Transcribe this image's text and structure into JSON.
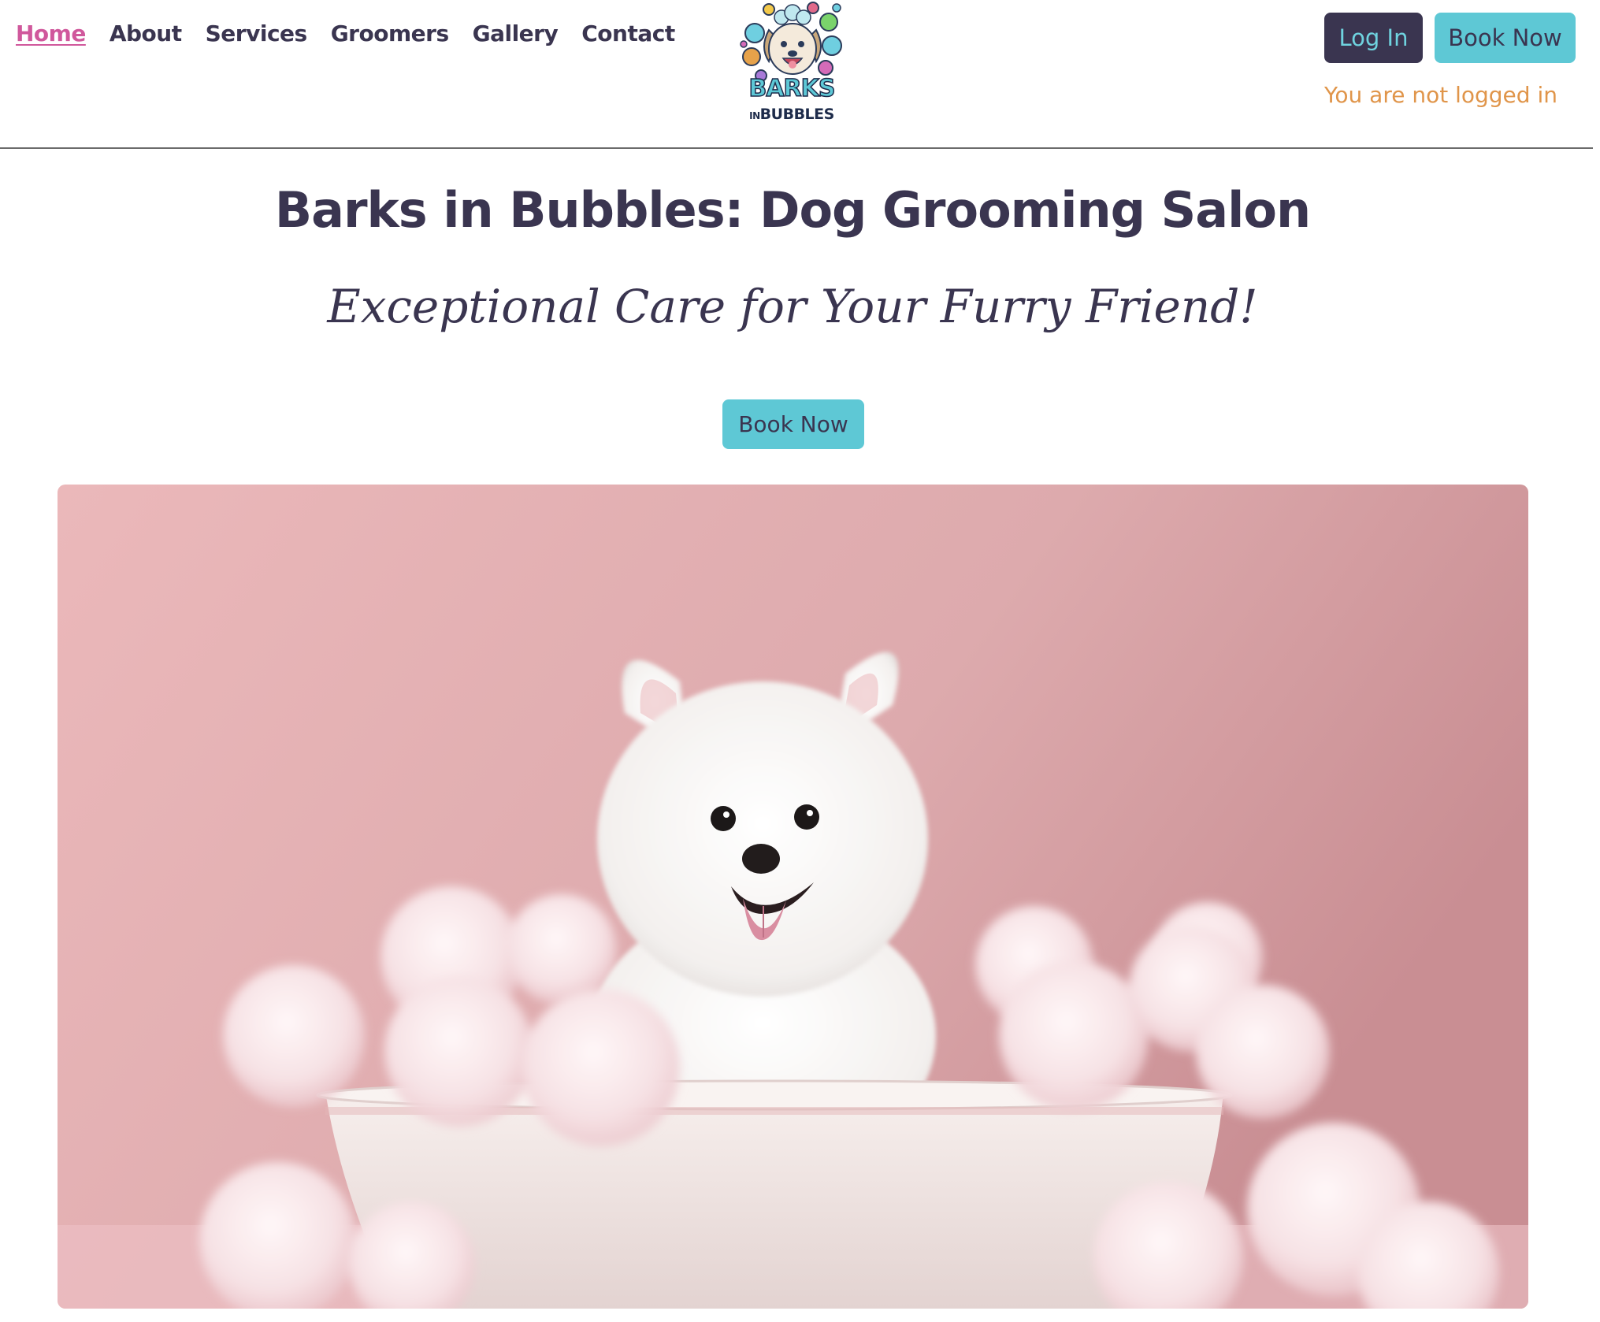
{
  "nav": {
    "items": [
      {
        "label": "Home",
        "active": true
      },
      {
        "label": "About",
        "active": false
      },
      {
        "label": "Services",
        "active": false
      },
      {
        "label": "Groomers",
        "active": false
      },
      {
        "label": "Gallery",
        "active": false
      },
      {
        "label": "Contact",
        "active": false
      }
    ]
  },
  "logo": {
    "line1": "BARKS",
    "line2_small": "IN",
    "line2": "BUBBLES"
  },
  "header": {
    "login_label": "Log In",
    "book_label": "Book Now",
    "status": "You are not logged in"
  },
  "hero": {
    "title": "Barks in Bubbles: Dog Grooming Salon",
    "subtitle": "Exceptional Care for Your Furry Friend!",
    "cta_label": "Book Now",
    "image_subject": "white-dog-in-bubble-bath"
  },
  "colors": {
    "primary_dark": "#3a3550",
    "accent_teal": "#5ec8d5",
    "active_pink": "#d0589c",
    "status_orange": "#e0954a",
    "hero_bg_pink": "#e3aeb1"
  }
}
